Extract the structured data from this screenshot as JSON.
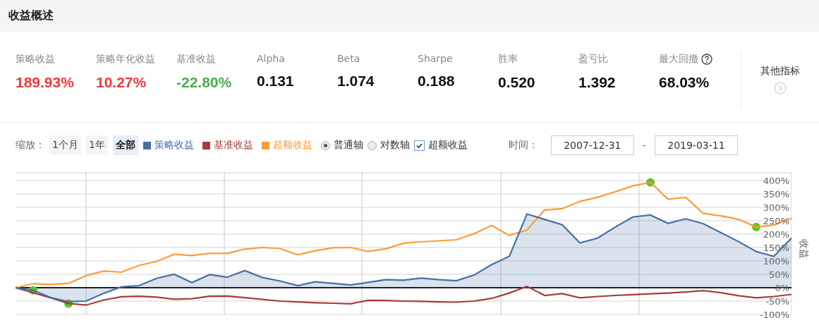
{
  "section": {
    "title": "收益概述"
  },
  "metrics": [
    {
      "label": "策略收益",
      "value": "189.93%",
      "color": "#f0393a"
    },
    {
      "label": "策略年化收益",
      "value": "10.27%",
      "color": "#f0393a"
    },
    {
      "label": "基准收益",
      "value": "-22.80%",
      "color": "#4cae4c"
    },
    {
      "label": "Alpha",
      "value": "0.131",
      "color": "#111111"
    },
    {
      "label": "Beta",
      "value": "1.074",
      "color": "#111111"
    },
    {
      "label": "Sharpe",
      "value": "0.188",
      "color": "#111111"
    },
    {
      "label": "胜率",
      "value": "0.520",
      "color": "#111111"
    },
    {
      "label": "盈亏比",
      "value": "1.392",
      "color": "#111111"
    },
    {
      "label": "最大回撤",
      "value": "68.03%",
      "color": "#111111",
      "help": true
    }
  ],
  "more_metrics": {
    "label": "其他指标"
  },
  "zoom": {
    "label": "缩放：",
    "options": [
      {
        "label": "1个月",
        "selected": false
      },
      {
        "label": "1年",
        "selected": false
      },
      {
        "label": "全部",
        "selected": true
      }
    ]
  },
  "axis_mode": [
    {
      "label": "普通轴",
      "selected": true
    },
    {
      "label": "对数轴",
      "selected": false
    }
  ],
  "excess_toggle": {
    "label": "超额收益",
    "checked": true
  },
  "date_range": {
    "label": "时间：",
    "start": "2007-12-31",
    "separator": "-",
    "end": "2019-03-11"
  },
  "chart": {
    "chart_data": {
      "type": "line",
      "ylabel": "收益",
      "categories": [
        null,
        null,
        null,
        null,
        null,
        null,
        null,
        null,
        null,
        null,
        null,
        null,
        null,
        null,
        null,
        null,
        null,
        null,
        null,
        null,
        null,
        null,
        null,
        null,
        null,
        null,
        null,
        null,
        null,
        null,
        null,
        null,
        null,
        null,
        null,
        null,
        null,
        null,
        null,
        null,
        null,
        null,
        null,
        null,
        null
      ],
      "ylim": [
        -100,
        400
      ],
      "grid": true,
      "yticks": [
        {
          "value": 400,
          "label": "400%"
        },
        {
          "value": 350,
          "label": "350%"
        },
        {
          "value": 300,
          "label": "300%"
        },
        {
          "value": 250,
          "label": "250%"
        },
        {
          "value": 200,
          "label": "200%"
        },
        {
          "value": 150,
          "label": "150%"
        },
        {
          "value": 100,
          "label": "100%"
        },
        {
          "value": 50,
          "label": "50%"
        },
        {
          "value": 0,
          "label": "0%"
        },
        {
          "value": -50,
          "label": "-50%"
        },
        {
          "value": -100,
          "label": "-100%"
        }
      ],
      "series": [
        {
          "name": "策略收益",
          "color": "#4470a5",
          "values": [
            0,
            -10,
            -37,
            -52,
            -50,
            -21,
            3,
            8,
            35,
            50,
            19,
            49,
            39,
            64,
            38,
            25,
            8,
            22,
            16,
            10,
            20,
            30,
            28,
            36,
            30,
            26,
            47,
            86,
            117,
            275,
            255,
            235,
            167,
            185,
            226,
            264,
            271,
            240,
            257,
            239,
            205,
            172,
            135,
            117,
            185
          ]
        },
        {
          "name": "基准收益",
          "color": "#a83c3a",
          "values": [
            0,
            -19,
            -38,
            -59,
            -65,
            -46,
            -34,
            -32,
            -35,
            -43,
            -41,
            -32,
            -31,
            -37,
            -44,
            -50,
            -53,
            -56,
            -58,
            -60,
            -47,
            -48,
            -50,
            -51,
            -53,
            -54,
            -50,
            -40,
            -20,
            5,
            -29,
            -22,
            -38,
            -33,
            -29,
            -26,
            -23,
            -20,
            -16,
            -11,
            -19,
            -30,
            -38,
            -33,
            -25
          ]
        },
        {
          "name": "超额收益",
          "color": "#fb9c39",
          "values": [
            0,
            15,
            12,
            16,
            45,
            62,
            58,
            83,
            98,
            125,
            120,
            128,
            128,
            144,
            150,
            146,
            123,
            138,
            149,
            150,
            135,
            145,
            166,
            171,
            175,
            179,
            201,
            232,
            195,
            215,
            290,
            295,
            322,
            337,
            358,
            380,
            393,
            330,
            337,
            277,
            268,
            255,
            226,
            234,
            260
          ]
        }
      ]
    }
  }
}
